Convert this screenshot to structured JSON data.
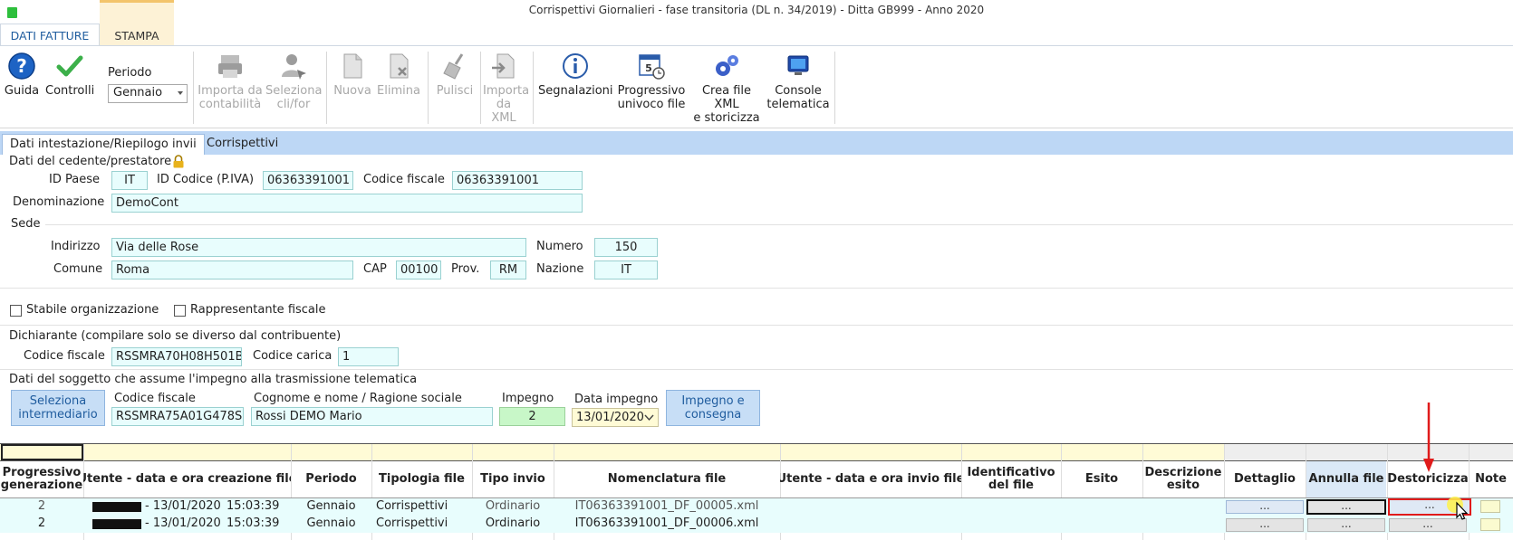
{
  "window": {
    "title": "Corrispettivi Giornalieri - fase transitoria (DL n. 34/2019) - Ditta GB999 - Anno 2020"
  },
  "ribbon_tabs": [
    "DATI FATTURE",
    "STAMPA"
  ],
  "ribbon": {
    "guida": "Guida",
    "controlli": "Controlli",
    "periodo_label": "Periodo",
    "periodo_value": "Gennaio",
    "importa_contabilita": [
      "Importa da",
      "contabilità"
    ],
    "seleziona_clifor": [
      "Seleziona",
      "cli/for"
    ],
    "nuova": "Nuova",
    "elimina": "Elimina",
    "pulisci": "Pulisci",
    "importa_xml": [
      "Importa",
      "da XML"
    ],
    "segnalazioni": "Segnalazioni",
    "progressivo": [
      "Progressivo",
      "univoco file"
    ],
    "crea_xml": [
      "Crea file XML",
      "e storicizza"
    ],
    "console": [
      "Console",
      "telematica"
    ]
  },
  "subtabs": [
    "Dati intestazione/Riepilogo invii",
    "Corrispettivi"
  ],
  "cedente": {
    "section_title": "Dati del cedente/prestatore",
    "id_paese_label": "ID Paese",
    "id_paese": "IT",
    "id_codice_label": "ID Codice (P.IVA)",
    "id_codice": "06363391001",
    "cf_label": "Codice fiscale",
    "cf": "06363391001",
    "denominazione_label": "Denominazione",
    "denominazione": "DemoCont"
  },
  "sede": {
    "section_title": "Sede",
    "indirizzo_label": "Indirizzo",
    "indirizzo": "Via delle Rose",
    "numero_label": "Numero",
    "numero": "150",
    "comune_label": "Comune",
    "comune": "Roma",
    "cap_label": "CAP",
    "cap": "00100",
    "prov_label": "Prov.",
    "prov": "RM",
    "nazione_label": "Nazione",
    "nazione": "IT"
  },
  "checks": {
    "stabile": "Stabile organizzazione",
    "rappresentante": "Rappresentante fiscale"
  },
  "dichiarante": {
    "section_title": "Dichiarante (compilare solo se diverso dal contribuente)",
    "cf_label": "Codice fiscale",
    "cf": "RSSMRA70H08H501B",
    "carica_label": "Codice carica",
    "carica": "1"
  },
  "impegno": {
    "section_title": "Dati del soggetto che assume l'impegno alla trasmissione telematica",
    "seleziona_btn": [
      "Seleziona",
      "intermediario"
    ],
    "cf_label": "Codice fiscale",
    "cf": "RSSMRA75A01G478S",
    "cognome_label": "Cognome e nome / Ragione sociale",
    "cognome": "Rossi DEMO Mario",
    "impegno_label": "Impegno",
    "impegno": "2",
    "data_label": "Data impegno",
    "data": "13/01/2020",
    "consegna_btn": [
      "Impegno e",
      "consegna"
    ]
  },
  "grid": {
    "headers": {
      "progressivo": [
        "Progressivo",
        "generazione"
      ],
      "utente_creazione": "Utente - data e ora creazione file",
      "periodo": "Periodo",
      "tipologia": "Tipologia file",
      "tipo_invio": "Tipo invio",
      "nomenclatura": "Nomenclatura file",
      "utente_invio": "Utente - data e ora invio file",
      "identificativo": [
        "Identificativo",
        "del file"
      ],
      "esito": "Esito",
      "descrizione": [
        "Descrizione",
        "esito"
      ],
      "dettaglio": "Dettaglio",
      "annulla": "Annulla file",
      "destoricizza": "Destoricizza",
      "note": "Note"
    },
    "rows": [
      {
        "progressivo": "2",
        "data": "- 13/01/2020",
        "ora": "15:03:39",
        "periodo": "Gennaio",
        "tipologia": "Corrispettivi",
        "tipo_invio": "Ordinario",
        "nomenclatura": "IT06363391001_DF_00005.xml",
        "btn": "..."
      },
      {
        "progressivo": "2",
        "data": "- 13/01/2020",
        "ora": "15:03:39",
        "periodo": "Gennaio",
        "tipologia": "Corrispettivi",
        "tipo_invio": "Ordinario",
        "nomenclatura": "IT06363391001_DF_00006.xml",
        "btn": "..."
      }
    ]
  },
  "colors": {
    "accent": "#1f5c9e",
    "highlight_red": "#e01b1b",
    "field_bg": "#e8fdfd",
    "header_band": "#fffbd6"
  }
}
